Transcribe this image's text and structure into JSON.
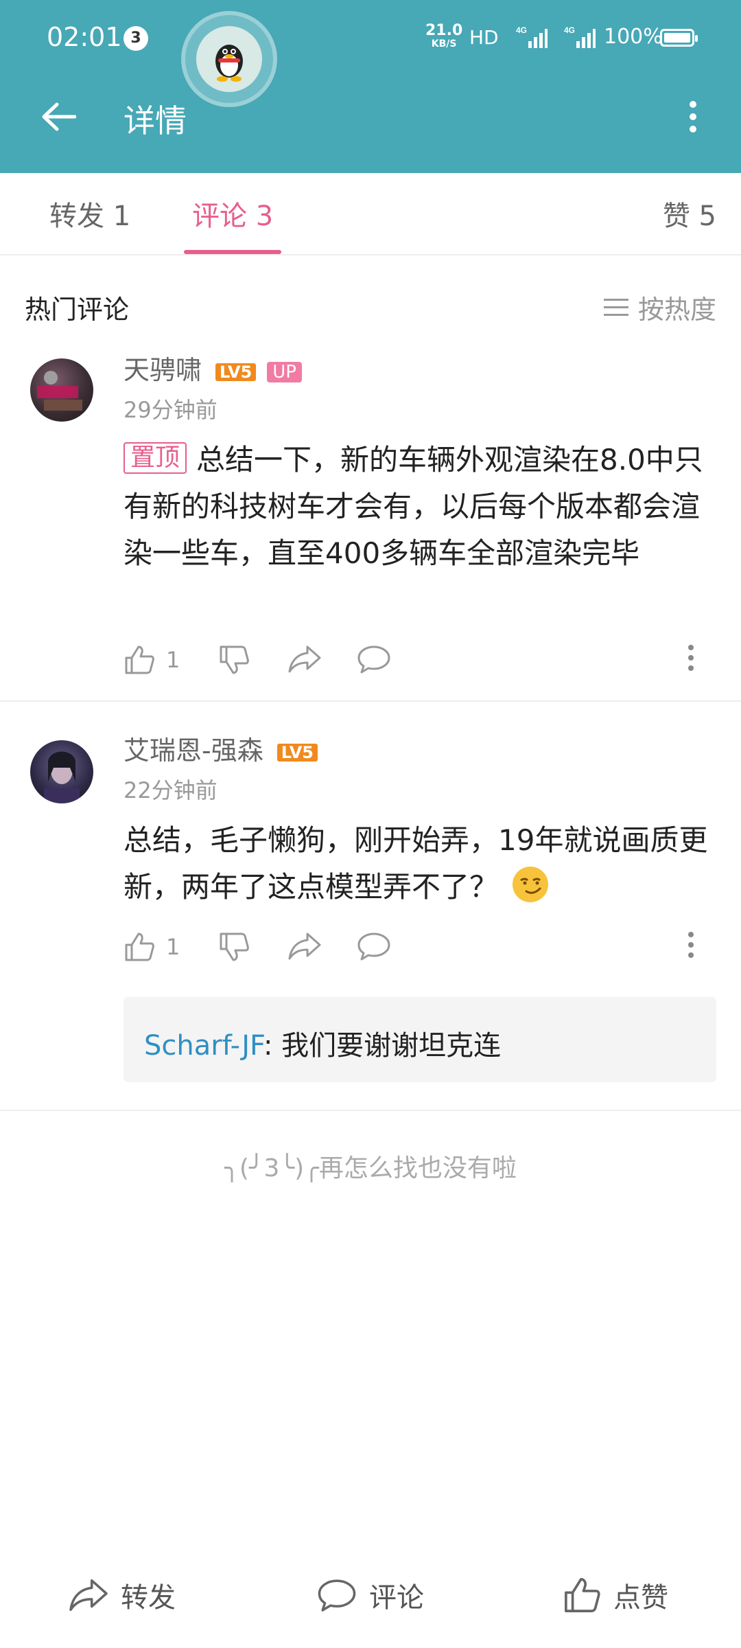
{
  "status_bar": {
    "time": "02:01",
    "notification_count": "3",
    "speed_value": "21.0",
    "speed_unit": "KB/S",
    "network": "HD",
    "battery": "100%"
  },
  "header": {
    "title": "详情"
  },
  "tabs": [
    {
      "label": "转发 1"
    },
    {
      "label": "评论 3"
    },
    {
      "label": "赞 5"
    }
  ],
  "section": {
    "label": "热门评论",
    "sort": "按热度"
  },
  "comments": [
    {
      "user": "天骋啸",
      "level": "LV5",
      "badge": "UP",
      "time": "29分钟前",
      "pinned": "置顶",
      "text": "总结一下，新的车辆外观渲染在8.0中只有新的科技树车才会有，以后每个版本都会渲染一些车，直至400多辆车全部渲染完毕",
      "likes": "1"
    },
    {
      "user": "艾瑞恩-强森",
      "level": "LV5",
      "time": "22分钟前",
      "text": "总结，毛子懒狗，刚开始弄，19年就说画质更新，两年了这点模型弄不了？",
      "likes": "1",
      "reply": {
        "user": "Scharf-JF",
        "text": ": 我们要谢谢坦克连"
      }
    }
  ],
  "end_note": "╮(╯3╰)╭再怎么找也没有啦",
  "bottom_bar": {
    "repost": "转发",
    "comment": "评论",
    "like": "点赞"
  },
  "colors": {
    "header": "#47a8b6",
    "accent": "#e75e8d",
    "level": "#f08a1e",
    "link": "#2f8fc3"
  }
}
